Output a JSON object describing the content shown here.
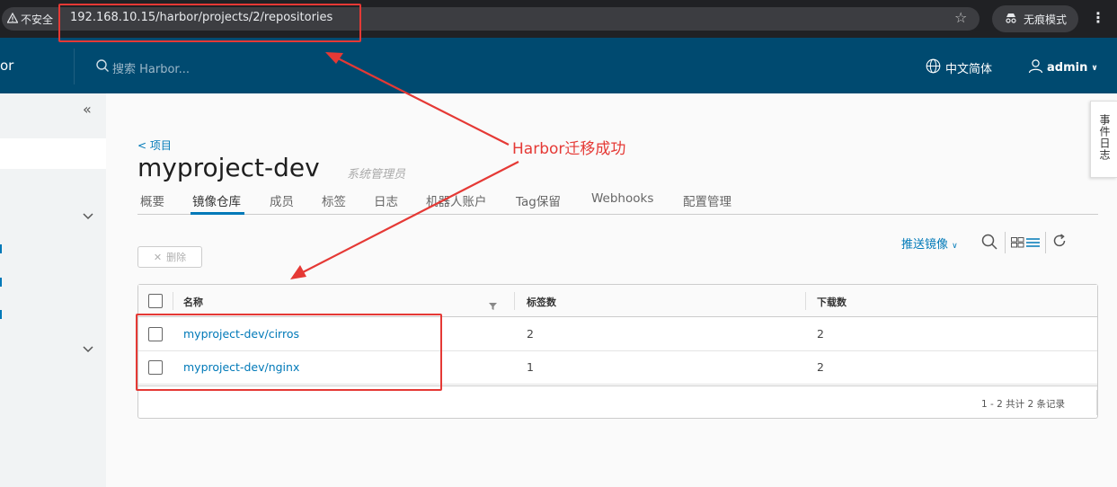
{
  "browser": {
    "security_label": "不安全",
    "url": "192.168.10.15/harbor/projects/2/repositories",
    "incognito_label": "无痕模式"
  },
  "header": {
    "brand": "or",
    "search_placeholder": "搜索 Harbor...",
    "language": "中文简体",
    "user": "admin"
  },
  "project": {
    "back_link": "< 项目",
    "name": "myproject-dev",
    "role": "系统管理员",
    "tabs": [
      {
        "label": "概要"
      },
      {
        "label": "镜像仓库"
      },
      {
        "label": "成员"
      },
      {
        "label": "标签"
      },
      {
        "label": "日志"
      },
      {
        "label": "机器人账户"
      },
      {
        "label": "Tag保留"
      },
      {
        "label": "Webhooks"
      },
      {
        "label": "配置管理"
      }
    ]
  },
  "toolbar": {
    "push_label": "推送镜像",
    "delete_label": "删除"
  },
  "grid": {
    "columns": [
      "名称",
      "标签数",
      "下载数"
    ],
    "rows": [
      {
        "name": "myproject-dev/cirros",
        "tags": "2",
        "pulls": "2"
      },
      {
        "name": "myproject-dev/nginx",
        "tags": "1",
        "pulls": "2"
      }
    ],
    "footer": "1 - 2 共计 2 条记录"
  },
  "event_log_label": "事件日志",
  "annotation": {
    "text": "Harbor迁移成功",
    "color": "#e53935"
  },
  "colors": {
    "header_bg": "#004a70",
    "link": "#0079b8"
  }
}
